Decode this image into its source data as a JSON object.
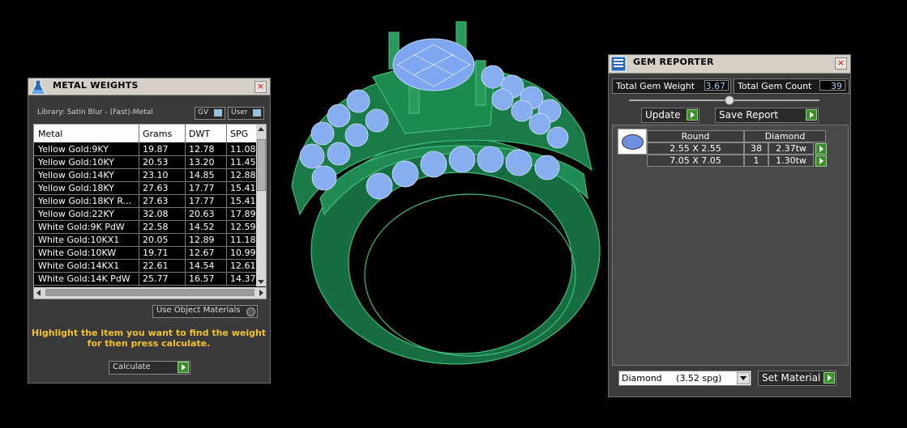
{
  "metal_weights": {
    "title": "METAL WEIGHTS",
    "library": "Library: Satin Blur - (Fast)-Metal",
    "toggle_gv": "GV",
    "toggle_user": "User",
    "columns": [
      "Metal",
      "Grams",
      "DWT",
      "SPG"
    ],
    "rows": [
      [
        "Yellow Gold:9KY",
        "19.87",
        "12.78",
        "11.08"
      ],
      [
        "Yellow Gold:10KY",
        "20.53",
        "13.20",
        "11.45"
      ],
      [
        "Yellow Gold:14KY",
        "23.10",
        "14.85",
        "12.88"
      ],
      [
        "Yellow Gold:18KY",
        "27.63",
        "17.77",
        "15.41"
      ],
      [
        "Yellow Gold:18KY R...",
        "27.63",
        "17.77",
        "15.41"
      ],
      [
        "Yellow Gold:22KY",
        "32.08",
        "20.63",
        "17.89"
      ],
      [
        "White Gold:9K PdW",
        "22.58",
        "14.52",
        "12.59"
      ],
      [
        "White Gold:10KX1",
        "20.05",
        "12.89",
        "11.18"
      ],
      [
        "White Gold:10KW",
        "19.71",
        "12.67",
        "10.99"
      ],
      [
        "White Gold:14KX1",
        "22.61",
        "14.54",
        "12.61"
      ],
      [
        "White Gold:14K PdW",
        "25.77",
        "16.57",
        "14.37"
      ]
    ],
    "use_object_materials": "Use Object Materials",
    "hint_line1": "Highlight the item you want to find the weight",
    "hint_line2": "for then press calculate.",
    "calculate_label": "Calculate"
  },
  "gem_reporter": {
    "title": "GEM REPORTER",
    "total_weight_label": "Total Gem Weight",
    "total_weight_value": "3.67",
    "total_count_label": "Total Gem Count",
    "total_count_value": "39",
    "update_label": "Update",
    "save_report_label": "Save Report",
    "shape_header": "Round",
    "material_header": "Diamond",
    "gems": [
      {
        "size": "2.55 X 2.55",
        "count": "38",
        "weight": "2.37tw"
      },
      {
        "size": "7.05 X 7.05",
        "count": "1",
        "weight": "1.30tw"
      }
    ],
    "material_select": "Diamond     (3.52 spg)",
    "set_material_label": "Set Material"
  },
  "colors": {
    "metal_green": "#1f7a4a",
    "gem_blue": "#8fb4f5",
    "accent_green": "#3a8f2a",
    "hint_yellow": "#f2c230"
  }
}
